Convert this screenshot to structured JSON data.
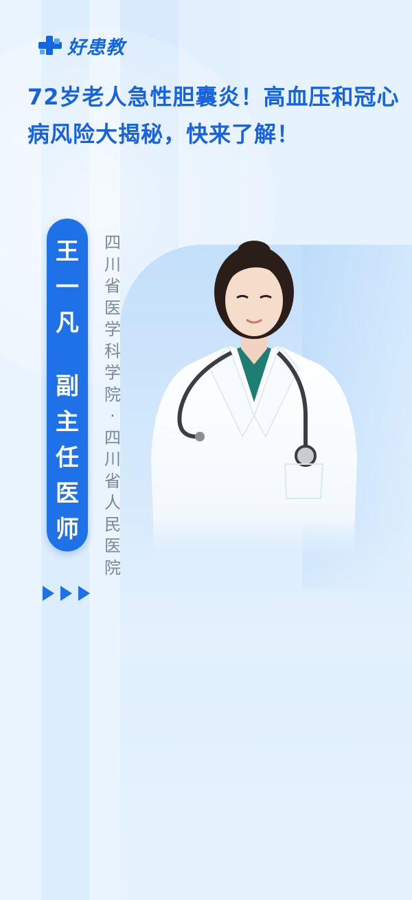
{
  "brand": {
    "name": "好患教",
    "icon": "plus-cross-logo-icon"
  },
  "title": "72岁老人急性胆囊炎！高血压和冠心病风险大揭秘，快来了解！",
  "doctor": {
    "name_chars": [
      "王",
      "一",
      "凡"
    ],
    "position_chars": [
      "副",
      "主",
      "任",
      "医",
      "师"
    ],
    "hospital_chars": [
      "四",
      "川",
      "省",
      "医",
      "学",
      "科",
      "学",
      "院",
      "·",
      "四",
      "川",
      "省",
      "人",
      "民",
      "医",
      "院"
    ]
  },
  "colors": {
    "accent": "#1f71e8",
    "title": "#1762de",
    "background": "#e3f0fd",
    "secondary_text": "#7a8896"
  },
  "icons": [
    "play-arrow-icon",
    "play-arrow-icon",
    "play-arrow-icon"
  ]
}
